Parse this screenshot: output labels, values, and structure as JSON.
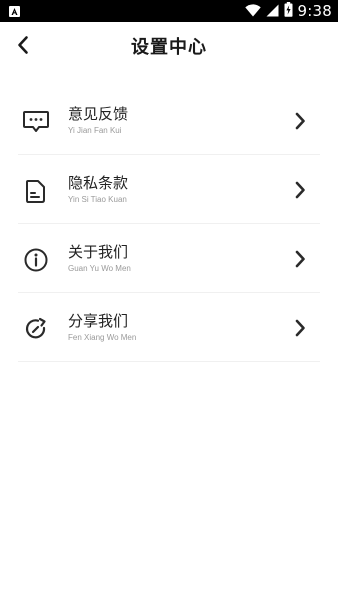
{
  "status_bar": {
    "time": "9:38",
    "notification_icon": "a-notification-icon",
    "icons": [
      "wifi-icon",
      "signal-icon",
      "battery-charging-icon"
    ]
  },
  "header": {
    "title": "设置中心",
    "back_icon": "chevron-left-icon"
  },
  "menu": {
    "items": [
      {
        "label": "意见反馈",
        "sublabel": "Yi Jian Fan Kui",
        "icon": "feedback-chat-icon"
      },
      {
        "label": "隐私条款",
        "sublabel": "Yin Si Tiao Kuan",
        "icon": "document-icon"
      },
      {
        "label": "关于我们",
        "sublabel": "Guan Yu Wo Men",
        "icon": "info-icon"
      },
      {
        "label": "分享我们",
        "sublabel": "Fen Xiang Wo Men",
        "icon": "share-rotate-icon"
      }
    ]
  },
  "colors": {
    "status_bar_bg": "#000000",
    "title": "#1a1a1a",
    "label": "#222222",
    "sublabel": "#9a9a9a",
    "divider": "#f0f0f0"
  }
}
